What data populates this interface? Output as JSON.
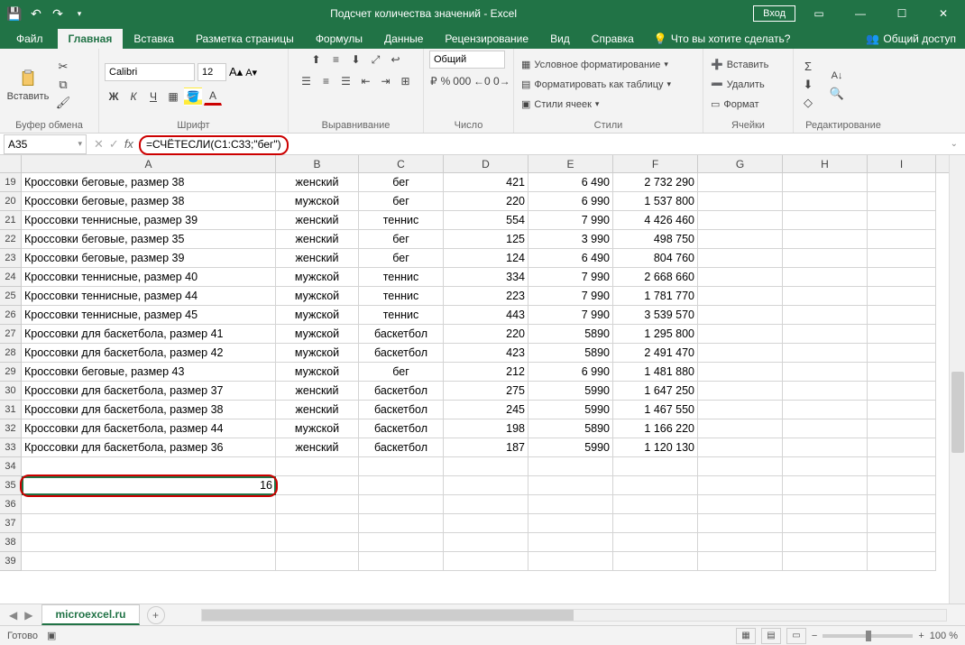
{
  "title": "Подсчет количества значений  -  Excel",
  "qat": {
    "login": "Вход"
  },
  "tabs": {
    "file": "Файл",
    "home": "Главная",
    "insert": "Вставка",
    "layout": "Разметка страницы",
    "formulas": "Формулы",
    "data": "Данные",
    "review": "Рецензирование",
    "view": "Вид",
    "help": "Справка",
    "tellme": "Что вы хотите сделать?",
    "share": "Общий доступ"
  },
  "ribbon": {
    "clipboard": {
      "paste": "Вставить",
      "label": "Буфер обмена"
    },
    "font": {
      "name": "Calibri",
      "size": "12",
      "label": "Шрифт",
      "bold": "Ж",
      "italic": "К",
      "underline": "Ч"
    },
    "alignment": {
      "label": "Выравнивание"
    },
    "number": {
      "combo": "Общий",
      "label": "Число"
    },
    "styles": {
      "cond": "Условное форматирование",
      "table": "Форматировать как таблицу",
      "cell": "Стили ячеек",
      "label": "Стили"
    },
    "cells": {
      "insert": "Вставить",
      "delete": "Удалить",
      "format": "Формат",
      "label": "Ячейки"
    },
    "editing": {
      "label": "Редактирование"
    }
  },
  "formula_bar": {
    "name_box": "A35",
    "formula": "=СЧЁТЕСЛИ(C1:C33;\"бег\")"
  },
  "columns": [
    "A",
    "B",
    "C",
    "D",
    "E",
    "F",
    "G",
    "H",
    "I"
  ],
  "row_start": 19,
  "rows": [
    {
      "n": 19,
      "a": "Кроссовки беговые, размер 38",
      "b": "женский",
      "c": "бег",
      "d": "421",
      "e": "6 490",
      "f": "2 732 290"
    },
    {
      "n": 20,
      "a": "Кроссовки беговые, размер 38",
      "b": "мужской",
      "c": "бег",
      "d": "220",
      "e": "6 990",
      "f": "1 537 800"
    },
    {
      "n": 21,
      "a": "Кроссовки теннисные, размер 39",
      "b": "женский",
      "c": "теннис",
      "d": "554",
      "e": "7 990",
      "f": "4 426 460"
    },
    {
      "n": 22,
      "a": "Кроссовки беговые, размер 35",
      "b": "женский",
      "c": "бег",
      "d": "125",
      "e": "3 990",
      "f": "498 750"
    },
    {
      "n": 23,
      "a": "Кроссовки беговые, размер 39",
      "b": "женский",
      "c": "бег",
      "d": "124",
      "e": "6 490",
      "f": "804 760"
    },
    {
      "n": 24,
      "a": "Кроссовки теннисные, размер 40",
      "b": "мужской",
      "c": "теннис",
      "d": "334",
      "e": "7 990",
      "f": "2 668 660"
    },
    {
      "n": 25,
      "a": "Кроссовки теннисные, размер 44",
      "b": "мужской",
      "c": "теннис",
      "d": "223",
      "e": "7 990",
      "f": "1 781 770"
    },
    {
      "n": 26,
      "a": "Кроссовки теннисные, размер 45",
      "b": "мужской",
      "c": "теннис",
      "d": "443",
      "e": "7 990",
      "f": "3 539 570"
    },
    {
      "n": 27,
      "a": "Кроссовки для баскетбола, размер 41",
      "b": "мужской",
      "c": "баскетбол",
      "d": "220",
      "e": "5890",
      "f": "1 295 800"
    },
    {
      "n": 28,
      "a": "Кроссовки для баскетбола, размер 42",
      "b": "мужской",
      "c": "баскетбол",
      "d": "423",
      "e": "5890",
      "f": "2 491 470"
    },
    {
      "n": 29,
      "a": "Кроссовки беговые, размер 43",
      "b": "мужской",
      "c": "бег",
      "d": "212",
      "e": "6 990",
      "f": "1 481 880"
    },
    {
      "n": 30,
      "a": "Кроссовки для баскетбола, размер 37",
      "b": "женский",
      "c": "баскетбол",
      "d": "275",
      "e": "5990",
      "f": "1 647 250"
    },
    {
      "n": 31,
      "a": "Кроссовки для баскетбола, размер 38",
      "b": "женский",
      "c": "баскетбол",
      "d": "245",
      "e": "5990",
      "f": "1 467 550"
    },
    {
      "n": 32,
      "a": "Кроссовки для баскетбола, размер 44",
      "b": "мужской",
      "c": "баскетбол",
      "d": "198",
      "e": "5890",
      "f": "1 166 220"
    },
    {
      "n": 33,
      "a": "Кроссовки для баскетбола, размер 36",
      "b": "женский",
      "c": "баскетбол",
      "d": "187",
      "e": "5990",
      "f": "1 120 130"
    },
    {
      "n": 34
    },
    {
      "n": 35,
      "a": "16",
      "selected": true,
      "a_num": true
    },
    {
      "n": 36
    },
    {
      "n": 37
    },
    {
      "n": 38
    },
    {
      "n": 39
    }
  ],
  "sheet": {
    "name": "microexcel.ru"
  },
  "status": {
    "ready": "Готово",
    "zoom": "100 %"
  }
}
